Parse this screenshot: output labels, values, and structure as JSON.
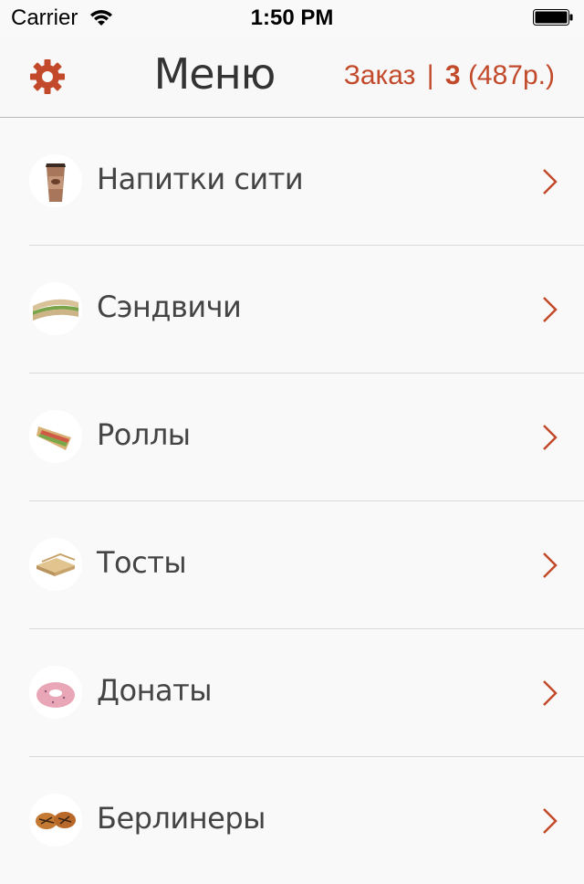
{
  "status_bar": {
    "carrier": "Carrier",
    "time": "1:50 PM"
  },
  "navbar": {
    "title": "Меню",
    "order_label": "Заказ",
    "order_separator": "|",
    "order_count": "3",
    "order_total": "(487р.)",
    "settings_icon": "gear-icon"
  },
  "colors": {
    "accent": "#c24a2b",
    "background": "#f9f9f9",
    "divider": "#d8d8d8"
  },
  "menu": {
    "items": [
      {
        "label": "Напитки сити",
        "icon": "coffee-cup-icon"
      },
      {
        "label": "Сэндвичи",
        "icon": "sandwich-icon"
      },
      {
        "label": "Роллы",
        "icon": "roll-icon"
      },
      {
        "label": "Тосты",
        "icon": "toast-icon"
      },
      {
        "label": "Донаты",
        "icon": "donut-icon"
      },
      {
        "label": "Берлинеры",
        "icon": "berliner-icon"
      }
    ]
  }
}
